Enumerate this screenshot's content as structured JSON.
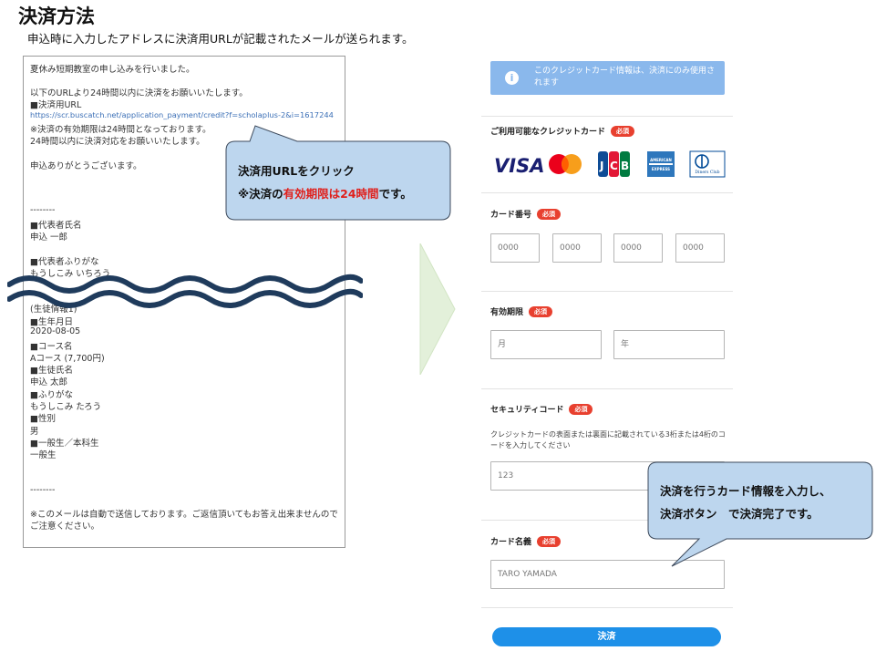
{
  "header": {
    "title": "決済方法",
    "subtitle": "申込時に入力したアドレスに決済用URLが記載されたメールが送られます。"
  },
  "email": {
    "lines": [
      "夏休み短期教室の申し込みを行いました。",
      "以下のURLより24時間以内に決済をお願いいたします。",
      "■決済用URL",
      "https://scr.buscatch.net/application_payment/credit?f=scholaplus-2&i=1617244",
      "※決済の有効期限は24時間となっております。",
      "24時間以内に決済対応をお願いいたします。",
      "申込ありがとうございます。",
      "--------",
      "■代表者氏名",
      "申込 一郎",
      "■代表者ふりがな",
      "もうしこみ いちろう",
      "(生徒情報1)",
      "■生年月日",
      "2020-08-05",
      "■コース名",
      "Aコース (7,700円)",
      "■生徒氏名",
      "申込 太郎",
      "■ふりがな",
      "もうしこみ たろう",
      "■性別",
      "男",
      "■一般生／本科生",
      "一般生",
      "--------",
      "※このメールは自動で送信しております。ご返信頂いてもお答え出来ませんのでご注意ください。"
    ]
  },
  "callout_top": {
    "line1": "決済用URLをクリック",
    "line2_a": "※決済の",
    "line2_b": "有効期限は24時間",
    "line2_c": "です。"
  },
  "callout_bottom": {
    "line1": "決済を行うカード情報を入力し、",
    "line2": "決済ボタン　で決済完了です。"
  },
  "form": {
    "info": "このクレジットカード情報は、決済にのみ使用されます",
    "required_badge": "必須",
    "cards_label": "ご利用可能なクレジットカード",
    "card_brands": [
      "VISA",
      "Mastercard",
      "JCB",
      "AMERICAN EXPRESS",
      "Diners Club INTERNATIONAL"
    ],
    "card_number_label": "カード番号",
    "card_number_placeholder": "0000",
    "expiry_label": "有効期限",
    "month_placeholder": "月",
    "year_placeholder": "年",
    "security_label": "セキュリティコード",
    "security_help": "クレジットカードの表面または裏面に記載されている3桁または4桁のコードを入力してください",
    "security_placeholder": "123",
    "name_label": "カード名義",
    "name_placeholder": "TARO YAMADA",
    "submit_label": "決済"
  },
  "colors": {
    "info_banner": "#8ab8ec",
    "required_badge": "#e8402f",
    "submit_button": "#1e90e8",
    "callout_fill": "#bdd6ee",
    "callout_border": "#3d4a5c",
    "highlight_red": "#e0201c",
    "wave": "#1f3b5c",
    "arrow_fill": "#e3f0da"
  }
}
